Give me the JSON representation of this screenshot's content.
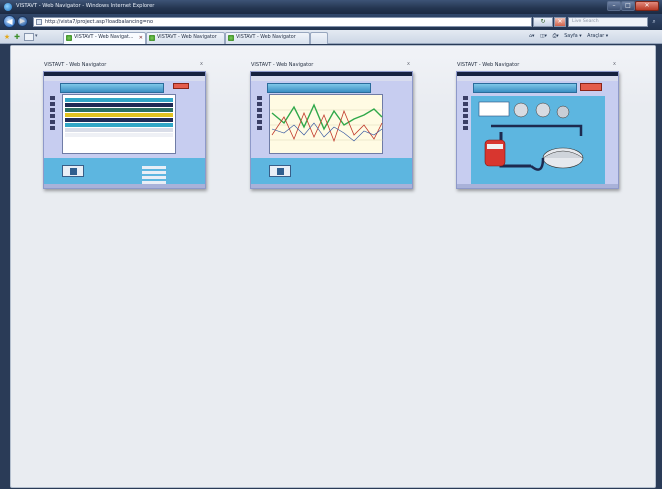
{
  "window": {
    "title": "VISTAVT - Web Navigator - Windows Internet Explorer"
  },
  "address_bar": {
    "url": "http://vista7/project.asp?loadbalancing=no",
    "search_placeholder": "Live Search"
  },
  "tabs": [
    {
      "label": "VISTAVT - Web Navigat...",
      "active": true
    },
    {
      "label": "VISTAVT - Web Navigator",
      "active": false
    },
    {
      "label": "VISTAVT - Web Navigator",
      "active": false
    }
  ],
  "command_bar": {
    "page_label": "Sayfa ▾",
    "tools_label": "Araçlar ▾"
  },
  "thumbnails": [
    {
      "title": "VISTAVT - Web Navigator",
      "close": "x",
      "content": "table"
    },
    {
      "title": "VISTAVT - Web Navigator",
      "close": "x",
      "content": "trend-chart"
    },
    {
      "title": "VISTAVT - Web Navigator",
      "close": "x",
      "content": "process-diagram"
    }
  ],
  "colors": {
    "titlebar": "#243550",
    "content_bg": "#e9ecf1",
    "thumb_bg": "#c7cdf0",
    "accent_blue": "#5db6e0"
  }
}
